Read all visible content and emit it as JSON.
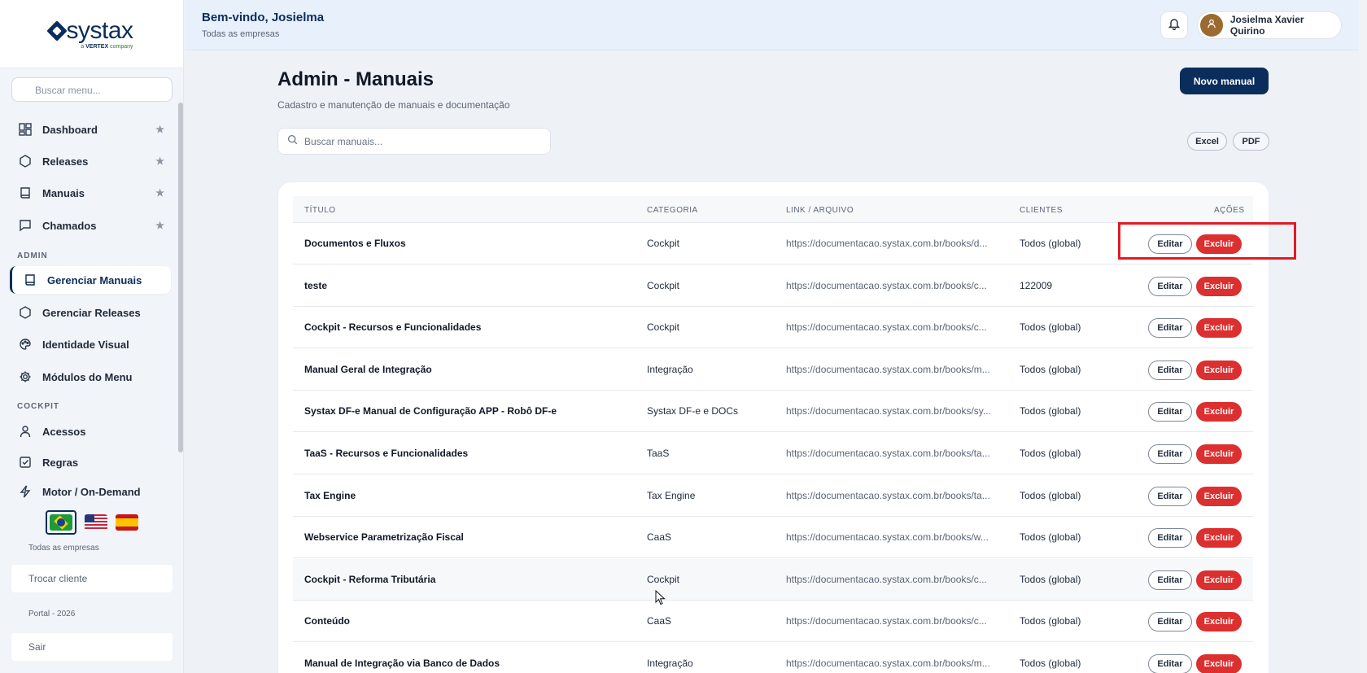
{
  "sidebar": {
    "logo_text": "systax",
    "logo_sub_prefix": "a",
    "logo_sub_brand": "VERTEX",
    "logo_sub_suffix": "company",
    "search_placeholder": "Buscar menu...",
    "items_main": [
      {
        "label": "Dashboard",
        "icon": "dashboard-icon",
        "star": "★"
      },
      {
        "label": "Releases",
        "icon": "hexagon-icon",
        "star": "★"
      },
      {
        "label": "Manuais",
        "icon": "book-icon",
        "star": "★"
      },
      {
        "label": "Chamados",
        "icon": "chat-icon",
        "star": "★"
      }
    ],
    "section_admin": "ADMIN",
    "items_admin": [
      {
        "label": "Gerenciar Manuais",
        "icon": "book-icon",
        "active": true
      },
      {
        "label": "Gerenciar Releases",
        "icon": "hexagon-icon"
      },
      {
        "label": "Identidade Visual",
        "icon": "palette-icon"
      },
      {
        "label": "Módulos do Menu",
        "icon": "gear-icon"
      }
    ],
    "section_cockpit": "COCKPIT",
    "items_cockpit": [
      {
        "label": "Acessos",
        "icon": "user-icon"
      },
      {
        "label": "Regras",
        "icon": "checkbox-icon"
      },
      {
        "label": "Motor / On-Demand",
        "icon": "lightning-icon"
      }
    ],
    "company_label": "Todas as empresas",
    "switch_client": "Trocar cliente",
    "portal_label": "Portal - 2026",
    "logout": "Sair"
  },
  "header": {
    "welcome": "Bem-vindo, Josielma",
    "company": "Todas as empresas",
    "user_name": "Josielma Xavier Quirino"
  },
  "page": {
    "title": "Admin - Manuais",
    "subtitle": "Cadastro e manutenção de manuais e documentação",
    "new_button": "Novo manual",
    "search_placeholder": "Buscar manuais...",
    "export_excel": "Excel",
    "export_pdf": "PDF"
  },
  "table": {
    "headers": {
      "title": "TÍTULO",
      "category": "CATEGORIA",
      "link": "LINK / ARQUIVO",
      "clients": "CLIENTES",
      "actions": "AÇÕES"
    },
    "edit_label": "Editar",
    "delete_label": "Excluir",
    "rows": [
      {
        "title": "Documentos e Fluxos",
        "category": "Cockpit",
        "link": "https://documentacao.systax.com.br/books/d...",
        "clients": "Todos (global)"
      },
      {
        "title": "teste",
        "category": "Cockpit",
        "link": "https://documentacao.systax.com.br/books/c...",
        "clients": "122009"
      },
      {
        "title": "Cockpit - Recursos e Funcionalidades",
        "category": "Cockpit",
        "link": "https://documentacao.systax.com.br/books/c...",
        "clients": "Todos (global)"
      },
      {
        "title": "Manual Geral de Integração",
        "category": "Integração",
        "link": "https://documentacao.systax.com.br/books/m...",
        "clients": "Todos (global)"
      },
      {
        "title": "Systax DF-e Manual de Configuração APP - Robô DF-e",
        "category": "Systax DF-e e DOCs",
        "link": "https://documentacao.systax.com.br/books/sy...",
        "clients": "Todos (global)"
      },
      {
        "title": "TaaS - Recursos e Funcionalidades",
        "category": "TaaS",
        "link": "https://documentacao.systax.com.br/books/ta...",
        "clients": "Todos (global)"
      },
      {
        "title": "Tax Engine",
        "category": "Tax Engine",
        "link": "https://documentacao.systax.com.br/books/ta...",
        "clients": "Todos (global)"
      },
      {
        "title": "Webservice Parametrização Fiscal",
        "category": "CaaS",
        "link": "https://documentacao.systax.com.br/books/w...",
        "clients": "Todos (global)"
      },
      {
        "title": "Cockpit - Reforma Tributária",
        "category": "Cockpit",
        "link": "https://documentacao.systax.com.br/books/c...",
        "clients": "Todos (global)"
      },
      {
        "title": "Conteúdo",
        "category": "CaaS",
        "link": "https://documentacao.systax.com.br/books/c...",
        "clients": "Todos (global)"
      },
      {
        "title": "Manual de Integração via Banco de Dados",
        "category": "Integração",
        "link": "https://documentacao.systax.com.br/books/m...",
        "clients": "Todos (global)"
      }
    ]
  },
  "colors": {
    "brand": "#0b2d5b",
    "danger": "#dc2f2f",
    "highlight": "#e01b24"
  }
}
